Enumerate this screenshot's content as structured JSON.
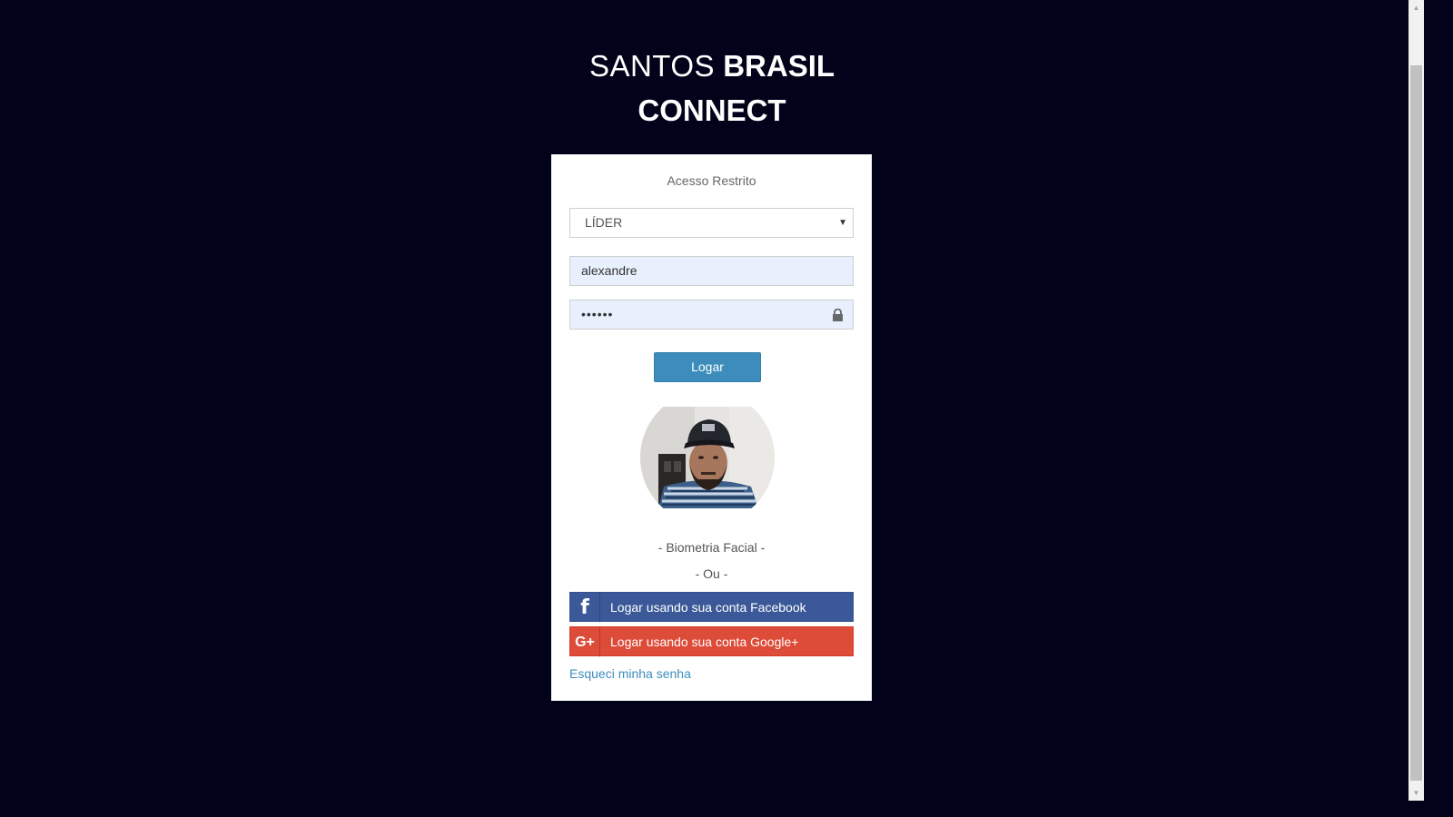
{
  "brand": {
    "light": "SANTOS",
    "bold": "BRASIL",
    "line2": "CONNECT"
  },
  "login": {
    "message": "Acesso Restrito",
    "profile_select": "LÍDER",
    "username": "alexandre",
    "password_mask": "••••••",
    "submit_label": "Logar",
    "biometric_label": "- Biometria Facial -",
    "or_label": "- Ou -",
    "facebook_label": "Logar usando sua conta Facebook",
    "google_label": "Logar usando sua conta Google+",
    "facebook_icon_glyph": "f",
    "google_icon_glyph": "G+",
    "forgot_label": "Esqueci minha senha"
  },
  "colors": {
    "background": "#02021a",
    "primary": "#3c8dbc",
    "facebook": "#3b5998",
    "google": "#dd4b39"
  }
}
